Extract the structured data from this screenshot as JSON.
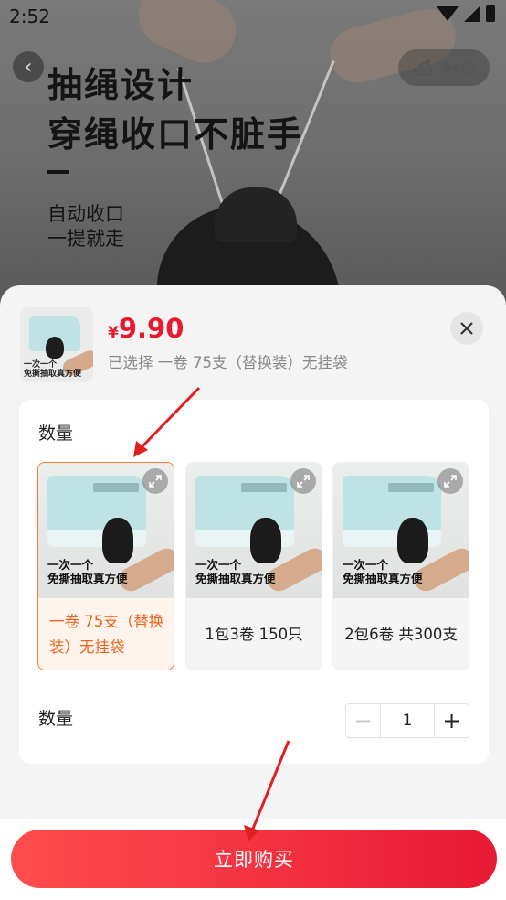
{
  "status_bar": {
    "time": "2:52"
  },
  "hero": {
    "headline_1": "抽绳设计",
    "headline_2": "穿绳收口不脏手",
    "subline_1": "自动收口",
    "subline_2": "一提就走",
    "share_label": "分享"
  },
  "sheet": {
    "currency": "¥",
    "price": "9.90",
    "selected_text": "已选择 一卷 75支（替换装）无挂袋",
    "thumb_caption_1": "一次一个",
    "thumb_caption_2": "免撕抽取真方便"
  },
  "spec": {
    "title": "数量",
    "options": [
      {
        "label": "一卷 75支（替换装）无挂袋",
        "caption_1": "一次一个",
        "caption_2": "免撕抽取真方便",
        "selected": true
      },
      {
        "label": "1包3卷 150只",
        "caption_1": "一次一个",
        "caption_2": "免撕抽取真方便",
        "selected": false
      },
      {
        "label": "2包6卷 共300支",
        "caption_1": "一次一个",
        "caption_2": "免撕抽取真方便",
        "selected": false
      }
    ]
  },
  "quantity": {
    "title": "数量",
    "minus": "−",
    "value": "1",
    "plus": "+"
  },
  "buy_button": {
    "label": "立即购买"
  },
  "colors": {
    "accent": "#e8182f",
    "selected_border": "#ff7a33",
    "selected_text": "#f0601d",
    "annotation": "#e02020"
  }
}
